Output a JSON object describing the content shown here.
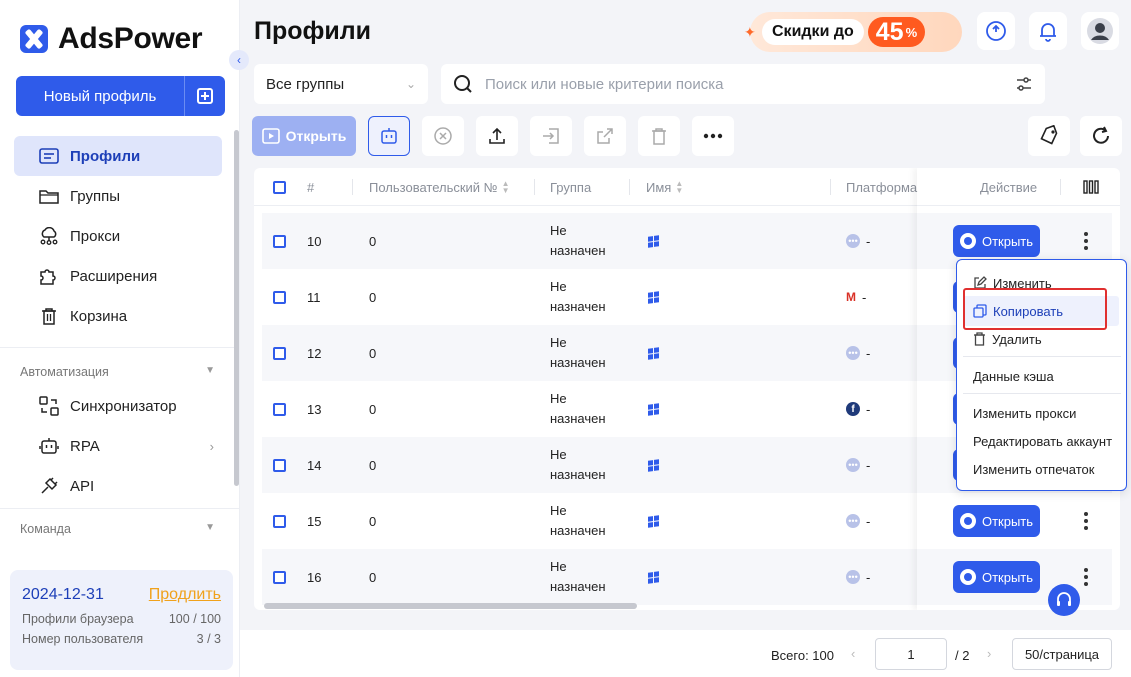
{
  "app": {
    "brand": "AdsPower"
  },
  "sidebar": {
    "new_profile_label": "Новый профиль",
    "items": [
      {
        "label": "Профили",
        "icon": "profiles-icon",
        "active": true
      },
      {
        "label": "Группы",
        "icon": "folder-icon"
      },
      {
        "label": "Прокси",
        "icon": "proxy-icon"
      },
      {
        "label": "Расширения",
        "icon": "puzzle-icon"
      },
      {
        "label": "Корзина",
        "icon": "trash-icon"
      }
    ],
    "automation_label": "Автоматизация",
    "automation_items": [
      {
        "label": "Синхронизатор",
        "icon": "sync-icon"
      },
      {
        "label": "RPA",
        "icon": "robot-icon"
      },
      {
        "label": "API",
        "icon": "plug-icon"
      }
    ],
    "team_label": "Команда",
    "subscription": {
      "date": "2024-12-31",
      "extend_label": "Продлить",
      "browser_profiles_label": "Профили браузера",
      "browser_profiles_value": "100 / 100",
      "users_label": "Номер пользователя",
      "users_value": "3 / 3"
    }
  },
  "header": {
    "title": "Профили",
    "promo_text": "Скидки до",
    "promo_value": "45",
    "promo_percent": "%"
  },
  "filters": {
    "group_select": "Все группы",
    "search_placeholder": "Поиск или новые критерии поиска"
  },
  "toolbar": {
    "open_label": "Открыть"
  },
  "table": {
    "columns": {
      "num": "#",
      "user_no": "Пользовательский №",
      "group": "Группа",
      "name": "Имя",
      "platform": "Платформа",
      "action": "Действие"
    },
    "rows": [
      {
        "num": "10",
        "user_no": "0",
        "group_l1": "Не",
        "group_l2": "назначен",
        "platform": "-",
        "platform_icon": "generic",
        "open": "Открыть"
      },
      {
        "num": "11",
        "user_no": "0",
        "group_l1": "Не",
        "group_l2": "назначен",
        "platform": "-",
        "platform_icon": "gmail",
        "open": "Открыть"
      },
      {
        "num": "12",
        "user_no": "0",
        "group_l1": "Не",
        "group_l2": "назначен",
        "platform": "-",
        "platform_icon": "generic",
        "open": "Открыть"
      },
      {
        "num": "13",
        "user_no": "0",
        "group_l1": "Не",
        "group_l2": "назначен",
        "platform": "-",
        "platform_icon": "facebook",
        "open": "Открыть"
      },
      {
        "num": "14",
        "user_no": "0",
        "group_l1": "Не",
        "group_l2": "назначен",
        "platform": "-",
        "platform_icon": "generic",
        "open": "Открыть"
      },
      {
        "num": "15",
        "user_no": "0",
        "group_l1": "Не",
        "group_l2": "назначен",
        "platform": "-",
        "platform_icon": "generic",
        "open": "Открыть"
      },
      {
        "num": "16",
        "user_no": "0",
        "group_l1": "Не",
        "group_l2": "назначен",
        "platform": "-",
        "platform_icon": "generic",
        "open": "Открыть"
      }
    ]
  },
  "context_menu": {
    "edit": "Изменить",
    "copy": "Копировать",
    "delete": "Удалить",
    "cache": "Данные кэша",
    "change_proxy": "Изменить прокси",
    "edit_account": "Редактировать аккаунт",
    "change_fingerprint": "Изменить отпечаток"
  },
  "pagination": {
    "total": "Всего: 100",
    "current": "1",
    "of": "/ 2",
    "page_size": "50/страница"
  },
  "colors": {
    "accent": "#2f5bea",
    "highlight_box": "#e03030",
    "promo": "#ff5a1f"
  }
}
